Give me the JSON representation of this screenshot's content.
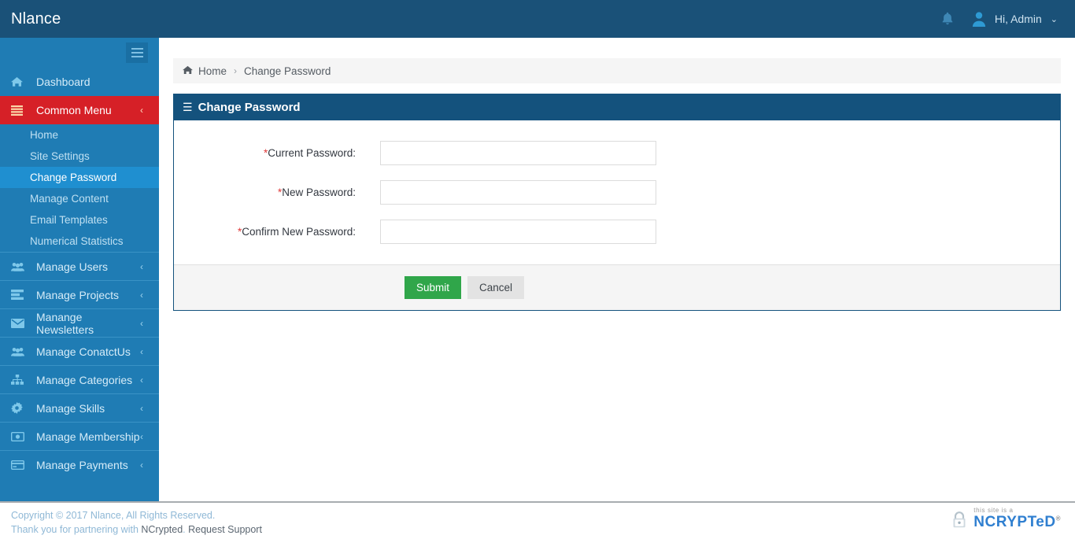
{
  "header": {
    "brand": "Nlance",
    "notification_icon": "bell-icon",
    "user_greeting": "Hi, Admin",
    "user_caret": "⌄"
  },
  "sidebar": {
    "toggle_icon": "hamburger-toggle-icon",
    "items": [
      {
        "label": "Dashboard",
        "icon": "home-icon",
        "caret": "",
        "state": "normal"
      },
      {
        "label": "Common Menu",
        "icon": "list-icon",
        "caret": "‹",
        "state": "active-red"
      }
    ],
    "submenu": [
      {
        "label": "Home",
        "selected": false
      },
      {
        "label": "Site Settings",
        "selected": false
      },
      {
        "label": "Change Password",
        "selected": true
      },
      {
        "label": "Manage Content",
        "selected": false
      },
      {
        "label": "Email Templates",
        "selected": false
      },
      {
        "label": "Numerical Statistics",
        "selected": false
      }
    ],
    "groups": [
      {
        "label": "Manage Users",
        "icon": "users-group-icon",
        "caret": "‹"
      },
      {
        "label": "Manage Projects",
        "icon": "server-list-icon",
        "caret": "‹"
      },
      {
        "label": "Manange Newsletters",
        "icon": "envelope-icon",
        "caret": "‹"
      },
      {
        "label": "Manage ConatctUs",
        "icon": "users-group-icon",
        "caret": "‹"
      },
      {
        "label": "Manage Categories",
        "icon": "sitemap-icon",
        "caret": "‹"
      },
      {
        "label": "Manage Skills",
        "icon": "gear-icon",
        "caret": "‹"
      },
      {
        "label": "Manage Membership",
        "icon": "money-bill-icon",
        "caret": "‹"
      },
      {
        "label": "Manage Payments",
        "icon": "credit-card-icon",
        "caret": "‹"
      }
    ]
  },
  "breadcrumb": {
    "home_label": "Home",
    "separator": "›",
    "current": "Change Password",
    "home_icon": "home-icon"
  },
  "panel": {
    "title": "Change Password",
    "title_icon": "bars-icon",
    "fields": [
      {
        "required_mark": "*",
        "label": "Current Password:",
        "value": "",
        "placeholder": ""
      },
      {
        "required_mark": "*",
        "label": "New Password:",
        "value": "",
        "placeholder": ""
      },
      {
        "required_mark": "*",
        "label": "Confirm New Password:",
        "value": "",
        "placeholder": ""
      }
    ],
    "submit_label": "Submit",
    "cancel_label": "Cancel"
  },
  "footer": {
    "copyright": "Copyright © 2017 Nlance, All Rights Reserved.",
    "partner_prefix": "Thank you for partnering with ",
    "partner_name": "NCrypted",
    "partner_suffix": ". ",
    "support_link": "Request Support",
    "logo_small": "this site is a",
    "logo_big": "NCRYPTeD",
    "logo_registered": "®",
    "logo_icon": "padlock-icon"
  },
  "colors": {
    "header_navy": "#1a5178",
    "sidebar_blue": "#1f7cb4",
    "active_red": "#d62027",
    "submenu_selected": "#1f8fd0",
    "panel_navy": "#14527d",
    "submit_green": "#30a64a",
    "cancel_gray": "#e3e3e3"
  }
}
